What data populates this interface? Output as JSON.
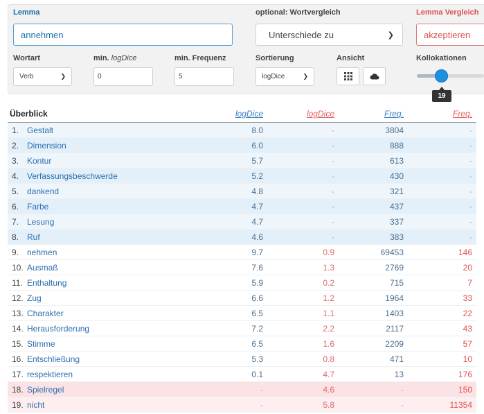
{
  "form": {
    "lemma_label": "Lemma",
    "lemma_value": "annehmen",
    "compare_label": "optional: Wortvergleich",
    "compare_value": "Unterschiede zu",
    "lemma2_label": "Lemma Vergleich",
    "lemma2_value": "akzeptieren",
    "wortart_label": "Wortart",
    "wortart_value": "Verb",
    "minlog_label_a": "min. ",
    "minlog_label_b": "logDice",
    "minlog_value": "0",
    "minfreq_label": "min. Frequenz",
    "minfreq_value": "5",
    "sort_label": "Sortierung",
    "sort_value": "logDice",
    "view_label": "Ansicht",
    "kollo_label": "Kollokationen",
    "kollo_value": "19",
    "kollo_fraction": 0.35
  },
  "table": {
    "headers": {
      "overview": "Überblick",
      "logdice1": "logDice",
      "logdice2": "logDice",
      "freq1": "Freq.",
      "freq2": "Freq."
    },
    "rows": [
      {
        "n": "1.",
        "word": "Gestalt",
        "ld1": "8.0",
        "ld2": "-",
        "f1": "3804",
        "f2": "-",
        "group": "blue"
      },
      {
        "n": "2.",
        "word": "Dimension",
        "ld1": "6.0",
        "ld2": "-",
        "f1": "888",
        "f2": "-",
        "group": "blue"
      },
      {
        "n": "3.",
        "word": "Kontur",
        "ld1": "5.7",
        "ld2": "-",
        "f1": "613",
        "f2": "-",
        "group": "blue"
      },
      {
        "n": "4.",
        "word": "Verfassungsbeschwerde",
        "ld1": "5.2",
        "ld2": "-",
        "f1": "430",
        "f2": "-",
        "group": "blue"
      },
      {
        "n": "5.",
        "word": "dankend",
        "ld1": "4.8",
        "ld2": "-",
        "f1": "321",
        "f2": "-",
        "group": "blue"
      },
      {
        "n": "6.",
        "word": "Farbe",
        "ld1": "4.7",
        "ld2": "-",
        "f1": "437",
        "f2": "-",
        "group": "blue"
      },
      {
        "n": "7.",
        "word": "Lesung",
        "ld1": "4.7",
        "ld2": "-",
        "f1": "337",
        "f2": "-",
        "group": "blue"
      },
      {
        "n": "8.",
        "word": "Ruf",
        "ld1": "4.6",
        "ld2": "-",
        "f1": "383",
        "f2": "-",
        "group": "blue"
      },
      {
        "n": "9.",
        "word": "nehmen",
        "ld1": "9.7",
        "ld2": "0.9",
        "f1": "69453",
        "f2": "146",
        "group": "white"
      },
      {
        "n": "10.",
        "word": "Ausmaß",
        "ld1": "7.6",
        "ld2": "1.3",
        "f1": "2769",
        "f2": "20",
        "group": "white"
      },
      {
        "n": "11.",
        "word": "Enthaltung",
        "ld1": "5.9",
        "ld2": "0.2",
        "f1": "715",
        "f2": "7",
        "group": "white"
      },
      {
        "n": "12.",
        "word": "Zug",
        "ld1": "6.6",
        "ld2": "1.2",
        "f1": "1964",
        "f2": "33",
        "group": "white"
      },
      {
        "n": "13.",
        "word": "Charakter",
        "ld1": "6.5",
        "ld2": "1.1",
        "f1": "1403",
        "f2": "22",
        "group": "white"
      },
      {
        "n": "14.",
        "word": "Herausforderung",
        "ld1": "7.2",
        "ld2": "2.2",
        "f1": "2117",
        "f2": "43",
        "group": "white"
      },
      {
        "n": "15.",
        "word": "Stimme",
        "ld1": "6.5",
        "ld2": "1.6",
        "f1": "2209",
        "f2": "57",
        "group": "white"
      },
      {
        "n": "16.",
        "word": "Entschließung",
        "ld1": "5.3",
        "ld2": "0.8",
        "f1": "471",
        "f2": "10",
        "group": "white"
      },
      {
        "n": "17.",
        "word": "respektieren",
        "ld1": "0.1",
        "ld2": "4.7",
        "f1": "13",
        "f2": "176",
        "group": "white"
      },
      {
        "n": "18.",
        "word": "Spielregel",
        "ld1": "-",
        "ld2": "4.6",
        "f1": "-",
        "f2": "150",
        "group": "red"
      },
      {
        "n": "19.",
        "word": "nicht",
        "ld1": "-",
        "ld2": "5.8",
        "f1": "-",
        "f2": "11354",
        "group": "red"
      }
    ]
  },
  "colors": {
    "primary": "#1e90e0",
    "compare": "#d9534f",
    "row_blue": "#e3f0fa",
    "row_red": "#fbe3e5"
  }
}
